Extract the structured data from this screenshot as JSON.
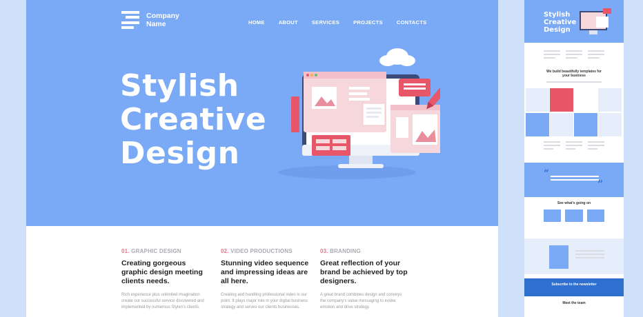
{
  "brand": {
    "name_line1": "Company",
    "name_line2": "Name"
  },
  "nav": [
    "HOME",
    "ABOUT",
    "SERVICES",
    "PROJECTS",
    "CONTACTS"
  ],
  "hero": {
    "line1": "Stylish",
    "line2": "Creative",
    "line3": "Design"
  },
  "features": [
    {
      "num": "01.",
      "kicker": "GRAPHIC DESIGN",
      "title": "Creating gorgeous graphic design meeting clients needs.",
      "body": "Rich experience plus unlimited imagination create our successful service discovered and implemented by numerous Stylen's clients."
    },
    {
      "num": "02.",
      "kicker": "VIDEO PRODUCTIONS",
      "title": "Stunning video sequence and impressing ideas are all here.",
      "body": "Creating and handling professional video is our point. It plays major role in your digital business strategy and serves our clients businesses."
    },
    {
      "num": "03.",
      "kicker": "BRANDING",
      "title": "Great reflection of your brand be achieved by top designers.",
      "body": "A great brand combines design and conveys the company's value messaging to evoke emotion and drive strategy."
    }
  ],
  "thumbnail": {
    "hero_line1": "Stylish",
    "hero_line2": "Creative",
    "hero_line3": "Design",
    "section_title": "We build beautifully templates for your business",
    "news_title": "See what's going on",
    "newsletter": "Subscribe to the newsletter",
    "team": "Meet the team"
  },
  "colors": {
    "hero_blue": "#7aa9f6",
    "accent_red": "#e8566a",
    "newsletter_blue": "#2f6fd0"
  }
}
